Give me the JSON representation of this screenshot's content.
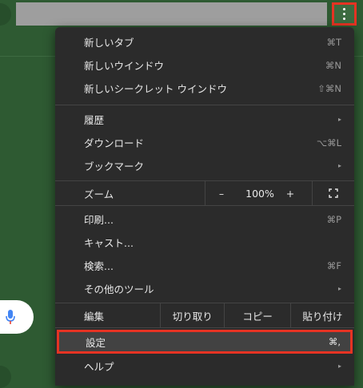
{
  "menu": {
    "new_tab": {
      "label": "新しいタブ",
      "shortcut": "⌘T"
    },
    "new_window": {
      "label": "新しいウインドウ",
      "shortcut": "⌘N"
    },
    "new_incognito": {
      "label": "新しいシークレット ウインドウ",
      "shortcut": "⇧⌘N"
    },
    "history": {
      "label": "履歴",
      "submenu": "▸"
    },
    "downloads": {
      "label": "ダウンロード",
      "shortcut": "⌥⌘L"
    },
    "bookmarks": {
      "label": "ブックマーク",
      "submenu": "▸"
    },
    "zoom": {
      "label": "ズーム",
      "minus": "–",
      "value": "100%",
      "plus": "+"
    },
    "print": {
      "label": "印刷...",
      "shortcut": "⌘P"
    },
    "cast": {
      "label": "キャスト..."
    },
    "find": {
      "label": "検索...",
      "shortcut": "⌘F"
    },
    "more_tools": {
      "label": "その他のツール",
      "submenu": "▸"
    },
    "edit": {
      "label": "編集",
      "cut": "切り取り",
      "copy": "コピー",
      "paste": "貼り付け"
    },
    "settings": {
      "label": "設定",
      "shortcut": "⌘,"
    },
    "help": {
      "label": "ヘルプ",
      "submenu": "▸"
    }
  },
  "colors": {
    "background": "#2e5a32",
    "menu_bg": "#2b2b2b",
    "highlight": "#e63323",
    "address_bar": "#9e9e9e",
    "mic_blue": "#4285f4",
    "mic_red": "#ea4335"
  },
  "icons": {
    "menu_button": "three-dots-vertical-icon",
    "fullscreen": "fullscreen-icon",
    "voice": "microphone-icon"
  }
}
